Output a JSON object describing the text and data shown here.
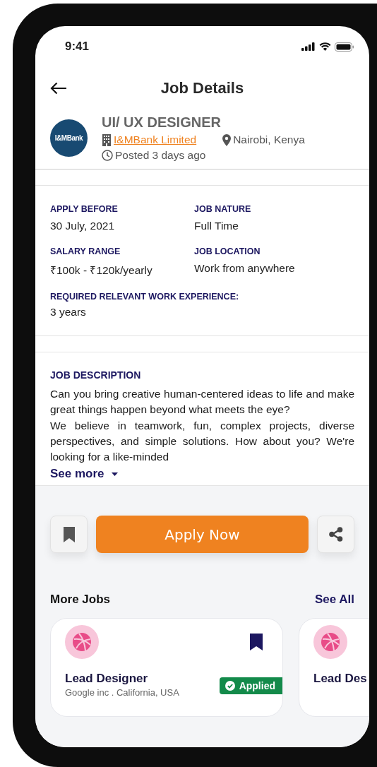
{
  "status_bar": {
    "time": "9:41"
  },
  "header": {
    "title": "Job Details"
  },
  "job": {
    "title": "UI/ UX DESIGNER",
    "logo_text": "I&MBank",
    "company": "I&MBank Limited",
    "location": "Nairobi, Kenya",
    "posted": "Posted 3 days ago"
  },
  "details": [
    {
      "kind": "half",
      "label": "APPLY BEFORE",
      "value": "30 July, 2021"
    },
    {
      "kind": "half",
      "label": "JOB NATURE",
      "value": "Full Time"
    },
    {
      "kind": "half",
      "label": "SALARY RANGE",
      "value": "₹100k - ₹120k/yearly"
    },
    {
      "kind": "half",
      "label": "JOB LOCATION",
      "value": "Work from anywhere"
    },
    {
      "kind": "full",
      "label": "REQUIRED RELEVANT WORK EXPERIENCE:",
      "value": "3 years"
    }
  ],
  "description": {
    "heading": "JOB DESCRIPTION",
    "paragraphs": [
      "Can you bring creative human-centered ideas to life and make great things happen beyond what meets the eye?",
      "We believe in teamwork, fun, complex projects, diverse perspectives, and simple solutions. How about you? We're looking for a like-minded"
    ],
    "see_more": "See more"
  },
  "actions": {
    "saved": false,
    "apply_label": "Apply Now"
  },
  "more_jobs": {
    "heading": "More Jobs",
    "see_all": "See All",
    "cards": [
      {
        "title": "Lead Designer",
        "company": "Google inc . California, USA",
        "saved": true,
        "applied": true,
        "applied_label": "Applied"
      },
      {
        "title": "Lead Des"
      }
    ]
  }
}
